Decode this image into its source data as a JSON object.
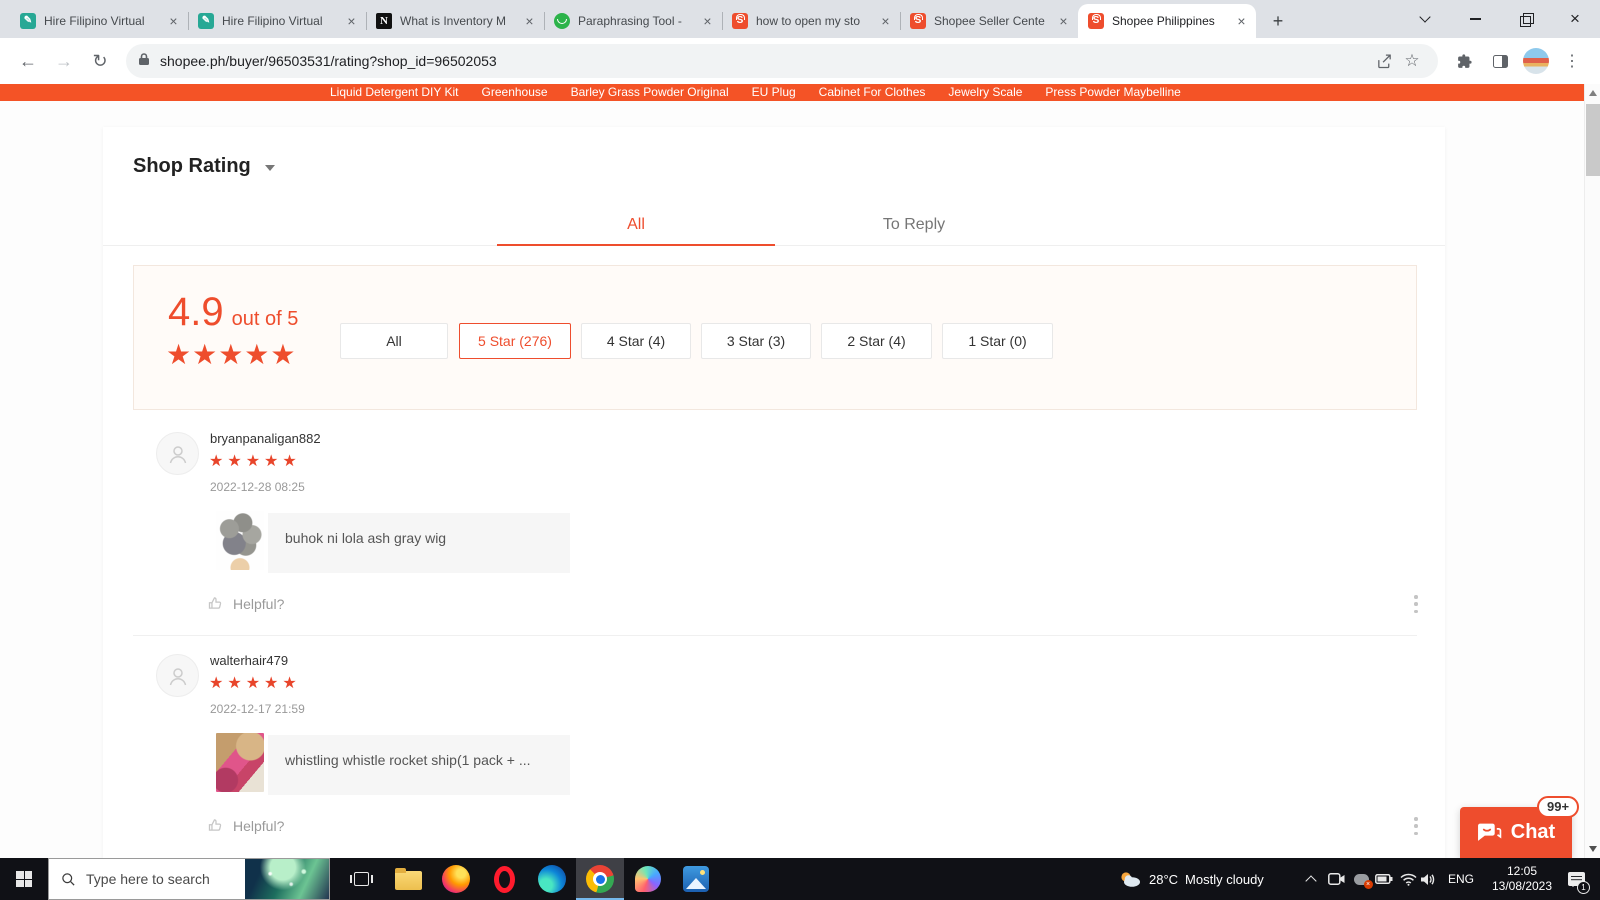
{
  "browser": {
    "tabs": [
      {
        "title": "Hire Filipino Virtual"
      },
      {
        "title": "Hire Filipino Virtual"
      },
      {
        "title": "What is Inventory M"
      },
      {
        "title": "Paraphrasing Tool -"
      },
      {
        "title": "how to open my sto"
      },
      {
        "title": "Shopee Seller Cente"
      },
      {
        "title": "Shopee Philippines"
      }
    ],
    "url": "shopee.ph/buyer/96503531/rating?shop_id=96502053"
  },
  "catbar": {
    "links": [
      "Liquid Detergent DIY Kit",
      "Greenhouse",
      "Barley Grass Powder Original",
      "EU Plug",
      "Cabinet For Clothes",
      "Jewelry Scale",
      "Press Powder Maybelline"
    ]
  },
  "shop": {
    "title": "Shop Rating",
    "tabs": [
      {
        "label": "All"
      },
      {
        "label": "To Reply"
      }
    ],
    "score": "4.9",
    "score_suffix": "out of 5",
    "score_stars": "★★★★★",
    "filters": [
      {
        "label": "All"
      },
      {
        "label": "5 Star (276)"
      },
      {
        "label": "4 Star (4)"
      },
      {
        "label": "3 Star (3)"
      },
      {
        "label": "2 Star (4)"
      },
      {
        "label": "1 Star (0)"
      }
    ],
    "helpful_label": "Helpful?",
    "reviews": [
      {
        "user": "bryanpanaligan882",
        "stars": "★★★★★",
        "date": "2022-12-28 08:25",
        "product": "buhok ni lola ash gray wig"
      },
      {
        "user": "walterhair479",
        "stars": "★★★★★",
        "date": "2022-12-17 21:59",
        "product": "whistling whistle rocket ship(1 pack + ..."
      }
    ],
    "chat": {
      "label": "Chat",
      "badge": "99+"
    }
  },
  "taskbar": {
    "search_placeholder": "Type here to search",
    "weather": {
      "temp": "28°C",
      "condition": "Mostly cloudy"
    },
    "lang": "ENG",
    "time": "12:05",
    "date": "13/08/2023",
    "notification_badge": "1"
  },
  "colors": {
    "accent": "#ee4d2d",
    "catbar": "#f45326"
  }
}
